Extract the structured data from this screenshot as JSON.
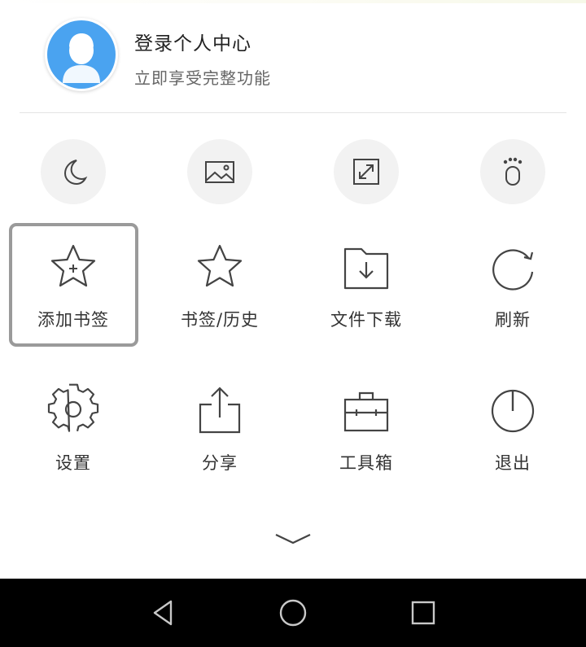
{
  "profile": {
    "title": "登录个人中心",
    "subtitle": "立即享受完整功能"
  },
  "toggles": [
    {
      "icon": "moon-icon",
      "name": "night-mode-toggle"
    },
    {
      "icon": "image-icon",
      "name": "no-image-toggle"
    },
    {
      "icon": "fullscreen-icon",
      "name": "fullscreen-toggle"
    },
    {
      "icon": "footprint-icon",
      "name": "incognito-toggle"
    }
  ],
  "menu": {
    "row1": [
      {
        "label": "添加书签",
        "icon": "star-plus-icon"
      },
      {
        "label": "书签/历史",
        "icon": "star-icon"
      },
      {
        "label": "文件下载",
        "icon": "download-folder-icon"
      },
      {
        "label": "刷新",
        "icon": "refresh-icon"
      }
    ],
    "row2": [
      {
        "label": "设置",
        "icon": "gear-icon"
      },
      {
        "label": "分享",
        "icon": "share-icon"
      },
      {
        "label": "工具箱",
        "icon": "toolbox-icon"
      },
      {
        "label": "退出",
        "icon": "power-icon"
      }
    ]
  },
  "navbar": {
    "buttons": [
      "back-icon",
      "home-icon",
      "recents-icon"
    ]
  },
  "colors": {
    "avatar_bg": "#4aa3f0",
    "icon_stroke": "#444444",
    "toggle_bg": "#f2f2f2",
    "selection_border": "#9a9a9a",
    "navbar_bg": "#000000"
  }
}
